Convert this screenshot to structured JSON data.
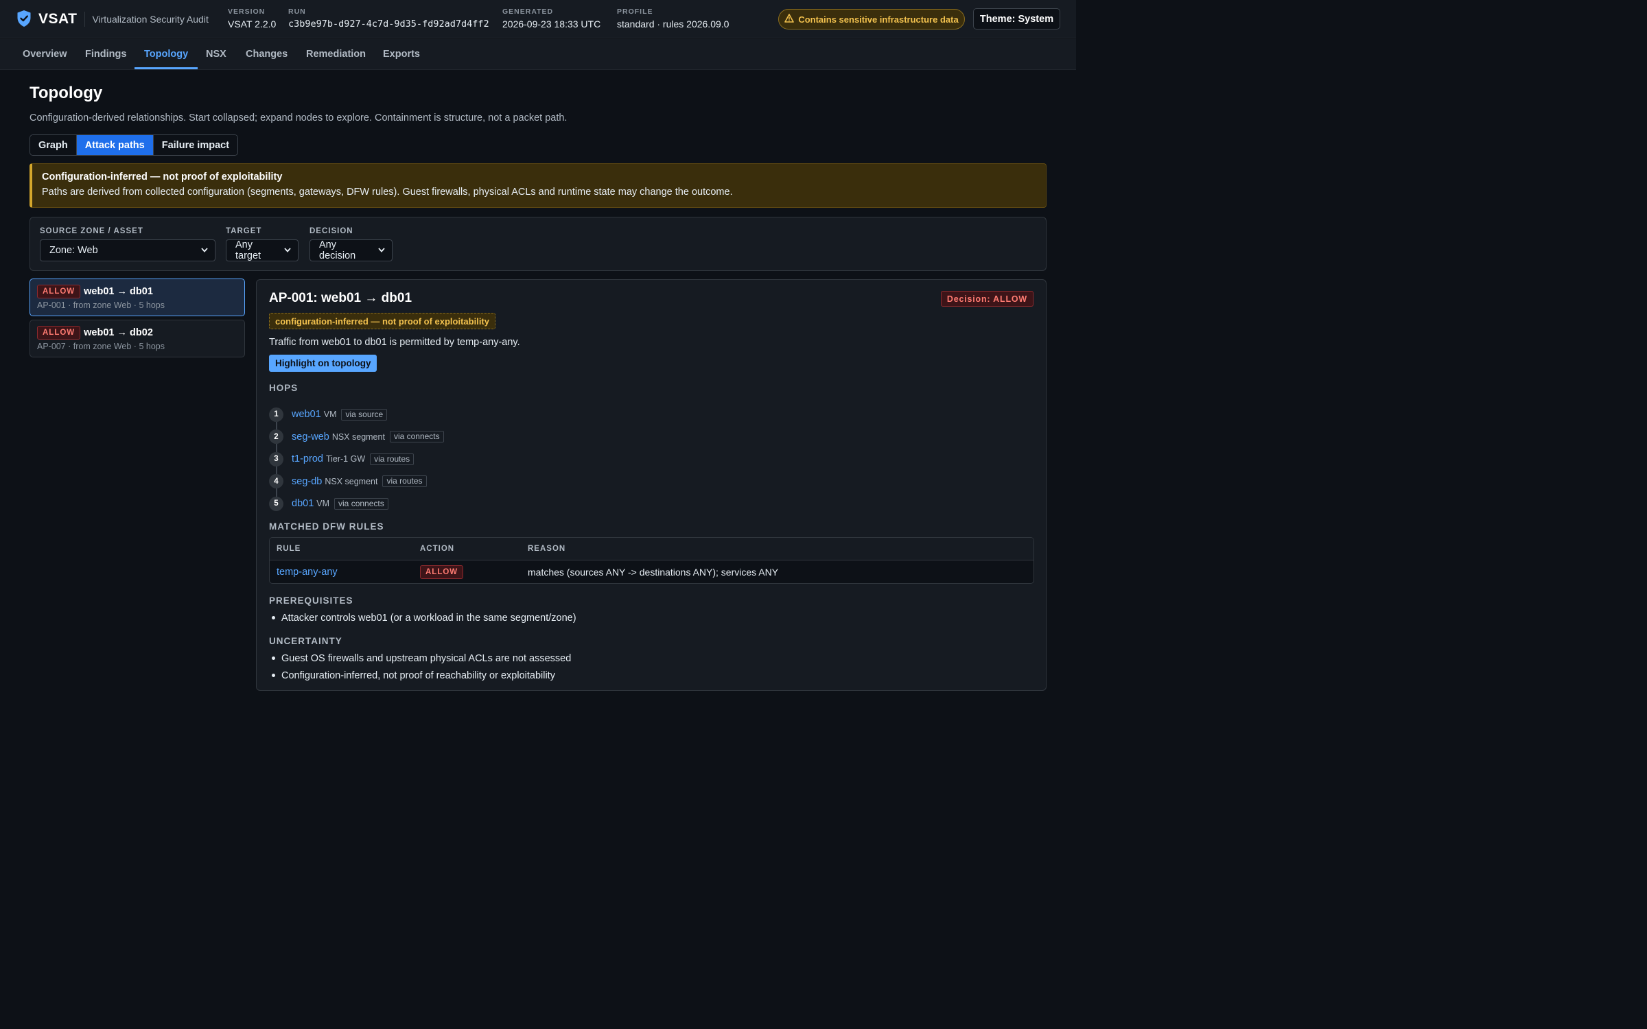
{
  "header": {
    "app_name": "VSAT",
    "subtitle": "Virtualization Security Audit",
    "meta": {
      "version_label": "VERSION",
      "version": "VSAT 2.2.0",
      "run_label": "RUN",
      "run": "c3b9e97b-d927-4c7d-9d35-fd92ad7d4ff2",
      "generated_label": "GENERATED",
      "generated": "2026-09-23 18:33 UTC",
      "profile_label": "PROFILE",
      "profile": "standard · rules 2026.09.0"
    },
    "sensitive_badge": "Contains sensitive infrastructure data",
    "theme_button": "Theme: System"
  },
  "nav": {
    "items": [
      "Overview",
      "Findings",
      "Topology",
      "NSX",
      "Changes",
      "Remediation",
      "Exports"
    ],
    "active": "Topology"
  },
  "page": {
    "title": "Topology",
    "description": "Configuration-derived relationships. Start collapsed; expand nodes to explore. Containment is structure, not a packet path.",
    "view_tabs": [
      "Graph",
      "Attack paths",
      "Failure impact"
    ],
    "active_tab": "Attack paths"
  },
  "warning": {
    "title": "Configuration-inferred — not proof of exploitability",
    "text": "Paths are derived from collected configuration (segments, gateways, DFW rules). Guest firewalls, physical ACLs and runtime state may change the outcome."
  },
  "filters": {
    "source_label": "SOURCE ZONE / ASSET",
    "source_value": "Zone: Web",
    "target_label": "TARGET",
    "target_value": "Any target",
    "decision_label": "DECISION",
    "decision_value": "Any decision"
  },
  "paths": [
    {
      "decision": "ALLOW",
      "title": "web01 → db01",
      "sub": "AP-001 · from zone Web · 5 hops",
      "selected": true
    },
    {
      "decision": "ALLOW",
      "title": "web01 → db02",
      "sub": "AP-007 · from zone Web · 5 hops",
      "selected": false
    }
  ],
  "detail": {
    "title": "AP-001: web01 → db01",
    "decision_badge": "Decision: ALLOW",
    "inferred_chip": "configuration-inferred — not proof of exploitability",
    "description": "Traffic from web01 to db01 is permitted by temp-any-any.",
    "highlight_button": "Highlight on topology",
    "hops_heading": "HOPS",
    "hops": [
      {
        "n": "1",
        "name": "web01",
        "type": "VM",
        "via": "via source"
      },
      {
        "n": "2",
        "name": "seg-web",
        "type": "NSX segment",
        "via": "via connects"
      },
      {
        "n": "3",
        "name": "t1-prod",
        "type": "Tier-1 GW",
        "via": "via routes"
      },
      {
        "n": "4",
        "name": "seg-db",
        "type": "NSX segment",
        "via": "via routes"
      },
      {
        "n": "5",
        "name": "db01",
        "type": "VM",
        "via": "via connects"
      }
    ],
    "rules_heading": "MATCHED DFW RULES",
    "rules_columns": [
      "RULE",
      "ACTION",
      "REASON"
    ],
    "rules": [
      {
        "rule": "temp-any-any",
        "action": "ALLOW",
        "reason": "matches (sources ANY -> destinations ANY); services ANY"
      }
    ],
    "prereq_heading": "PREREQUISITES",
    "prerequisites": [
      "Attacker controls web01 (or a workload in the same segment/zone)"
    ],
    "uncertainty_heading": "UNCERTAINTY",
    "uncertainty": [
      "Guest OS firewalls and upstream physical ACLs are not assessed",
      "Configuration-inferred, not proof of reachability or exploitability"
    ]
  },
  "colors": {
    "background": "#0d1117",
    "surface": "#161b22",
    "accent": "#58a6ff",
    "allow": "#ff7b72",
    "warning": "#f2c14e"
  }
}
